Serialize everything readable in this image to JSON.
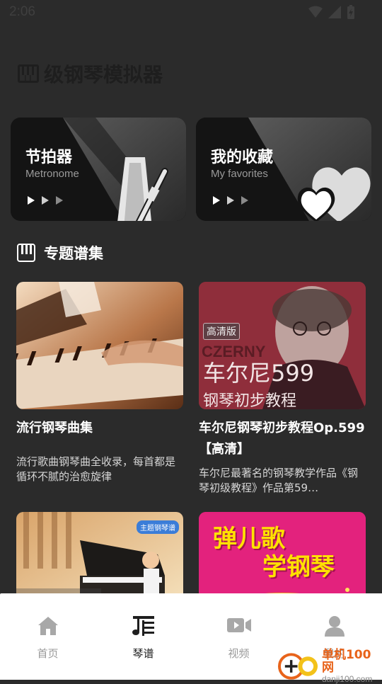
{
  "status": {
    "time": "2:06"
  },
  "app_title": "级钢琴模拟器",
  "cards": [
    {
      "title": "节拍器",
      "subtitle": "Metronome"
    },
    {
      "title": "我的收藏",
      "subtitle": "My favorites"
    }
  ],
  "section": {
    "title": "专题谱集"
  },
  "items": [
    {
      "title": "流行钢琴曲集",
      "desc": "流行歌曲钢琴曲全收录，每首都是循环不腻的治愈旋律",
      "thumb_text": []
    },
    {
      "title": "车尔尼钢琴初步教程Op.599【高清】",
      "desc": "车尔尼最著名的钢琴教学作品《钢琴初级教程》作品第59…",
      "thumb_text": [
        "高清版",
        "CZERNY",
        "车尔尼599",
        "钢琴初步教程"
      ]
    },
    {
      "title": "",
      "desc": "",
      "thumb_text": [
        "主题钢琴谱"
      ]
    },
    {
      "title": "",
      "desc": "",
      "thumb_text": [
        "弹儿歌",
        "学钢琴"
      ]
    }
  ],
  "tabs": [
    {
      "label": "首页",
      "icon": "home-icon",
      "active": false
    },
    {
      "label": "琴谱",
      "icon": "sheet-music-icon",
      "active": true
    },
    {
      "label": "视频",
      "icon": "video-icon",
      "active": false
    },
    {
      "label": "我的",
      "icon": "user-icon",
      "active": false
    }
  ],
  "watermark": {
    "name": "单机100网",
    "url": "danji100.com"
  },
  "colors": {
    "background": "#2b2b2b",
    "tabbar": "#ffffff",
    "accent_watermark": "#e8631a"
  }
}
